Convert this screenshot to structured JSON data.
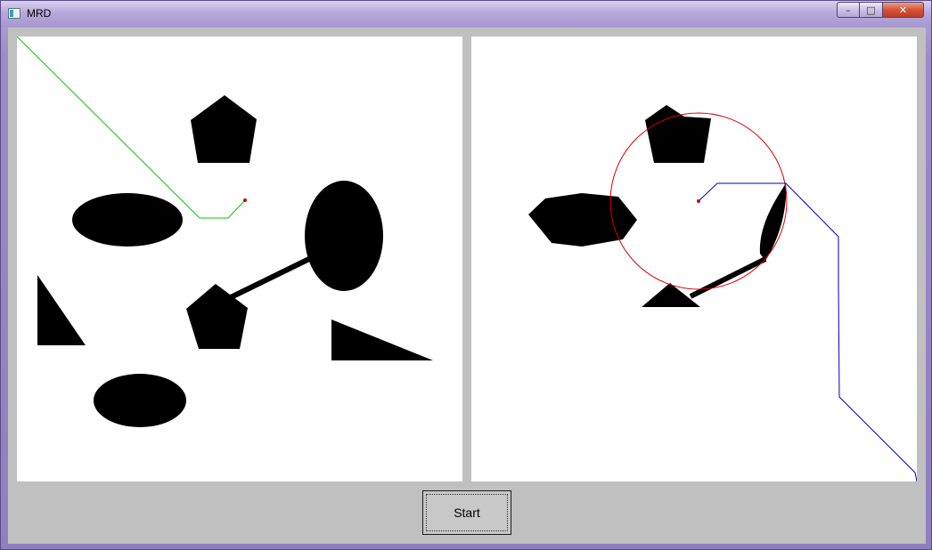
{
  "window": {
    "title": "MRD",
    "controls": {
      "minimize": "–",
      "maximize": "□",
      "close": "✕"
    }
  },
  "buttons": {
    "start_label": "Start"
  },
  "colors": {
    "obstacle": "#000000",
    "path_left": "#00c800",
    "path_right": "#0000c0",
    "sensor_range": "#dd0000",
    "robot": "#cc0000"
  }
}
